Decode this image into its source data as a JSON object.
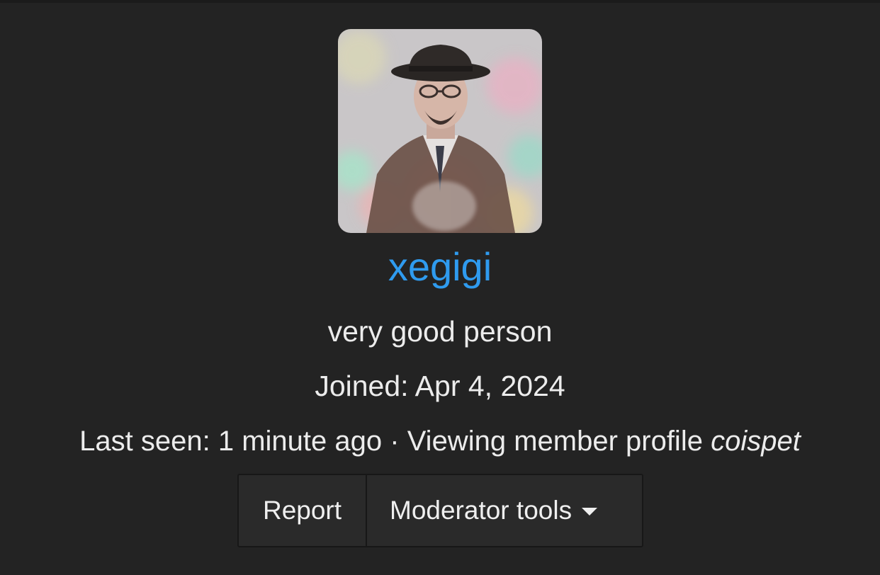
{
  "profile": {
    "username": "xegigi",
    "tagline": "very good person",
    "joined_label": "Joined:",
    "joined_date": "Apr 4, 2024",
    "last_seen_label": "Last seen:",
    "last_seen_value": "1 minute ago",
    "separator": "·",
    "activity_text": "Viewing member profile",
    "activity_target": "coispet",
    "username_color": "#2f9bef"
  },
  "actions": {
    "report_label": "Report",
    "moderator_tools_label": "Moderator tools",
    "moderator_tools_icon": "caret-down-icon"
  },
  "colors": {
    "background": "#232323",
    "button_bg": "#2a2a2a",
    "text": "#ececec"
  }
}
